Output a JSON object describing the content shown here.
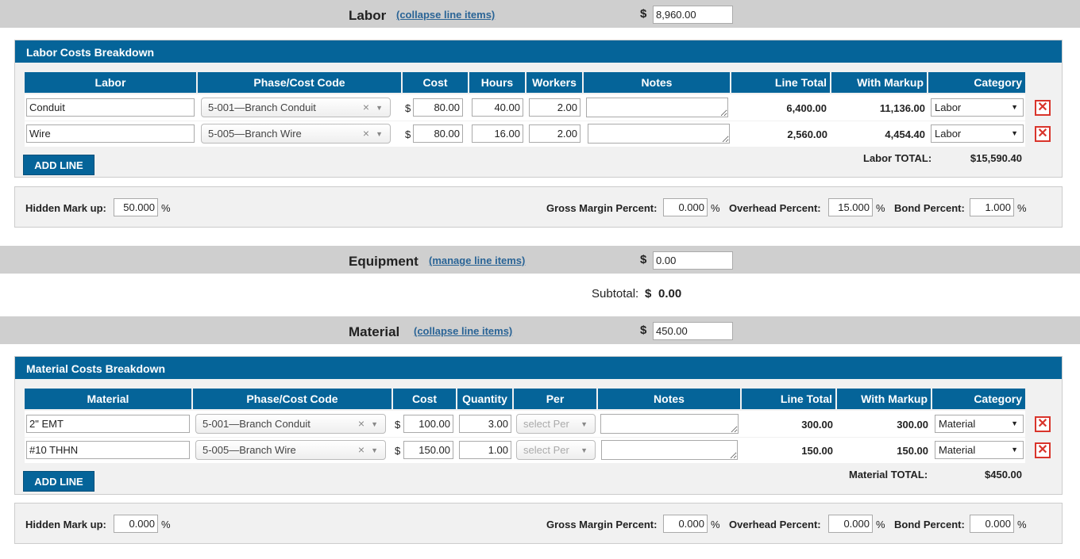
{
  "currency": "$",
  "pct": "%",
  "del_glyph": "✕",
  "clear_glyph": "×",
  "arrow_glyph": "▼",
  "colors": {
    "header_blue": "#056499",
    "section_grey": "#cfcfcf",
    "delete_red": "#d9342b",
    "link_blue": "#2a6496"
  },
  "labor": {
    "title": "Labor",
    "link": "(collapse line items)",
    "amount": "8,960.00",
    "panel_title": "Labor Costs Breakdown",
    "headers": {
      "item": "Labor",
      "phase": "Phase/Cost Code",
      "cost": "Cost",
      "qty": "Hours",
      "workers": "Workers",
      "notes": "Notes",
      "line_total": "Line Total",
      "with_markup": "With Markup",
      "category": "Category"
    },
    "rows": [
      {
        "item": "Conduit",
        "phase": "5-001—Branch Conduit",
        "cost": "80.00",
        "qty": "40.00",
        "workers": "2.00",
        "line_total": "6,400.00",
        "with_markup": "11,136.00",
        "category": "Labor"
      },
      {
        "item": "Wire",
        "phase": "5-005—Branch Wire",
        "cost": "80.00",
        "qty": "16.00",
        "workers": "2.00",
        "line_total": "2,560.00",
        "with_markup": "4,454.40",
        "category": "Labor"
      }
    ],
    "add_line": "ADD LINE",
    "total_label": "Labor TOTAL:",
    "total_value": "$15,590.40",
    "markup": {
      "hidden_label": "Hidden Mark up:",
      "hidden": "50.000",
      "gm_label": "Gross Margin Percent:",
      "gm": "0.000",
      "oh_label": "Overhead Percent:",
      "oh": "15.000",
      "bond_label": "Bond Percent:",
      "bond": "1.000"
    }
  },
  "equipment": {
    "title": "Equipment",
    "link": "(manage line items)",
    "amount": "0.00",
    "subtotal_label": "Subtotal:",
    "subtotal_value": "0.00"
  },
  "material": {
    "title": "Material",
    "link": "(collapse line items)",
    "amount": "450.00",
    "panel_title": "Material Costs Breakdown",
    "headers": {
      "item": "Material",
      "phase": "Phase/Cost Code",
      "cost": "Cost",
      "qty": "Quantity",
      "per": "Per",
      "notes": "Notes",
      "line_total": "Line Total",
      "with_markup": "With Markup",
      "category": "Category"
    },
    "rows": [
      {
        "item": "2\" EMT",
        "phase": "5-001—Branch Conduit",
        "cost": "100.00",
        "qty": "3.00",
        "per": "select Per",
        "line_total": "300.00",
        "with_markup": "300.00",
        "category": "Material"
      },
      {
        "item": "#10 THHN",
        "phase": "5-005—Branch Wire",
        "cost": "150.00",
        "qty": "1.00",
        "per": "select Per",
        "line_total": "150.00",
        "with_markup": "150.00",
        "category": "Material"
      }
    ],
    "add_line": "ADD LINE",
    "total_label": "Material TOTAL:",
    "total_value": "$450.00",
    "markup": {
      "hidden_label": "Hidden Mark up:",
      "hidden": "0.000",
      "gm_label": "Gross Margin Percent:",
      "gm": "0.000",
      "oh_label": "Overhead Percent:",
      "oh": "0.000",
      "bond_label": "Bond Percent:",
      "bond": "0.000"
    }
  }
}
